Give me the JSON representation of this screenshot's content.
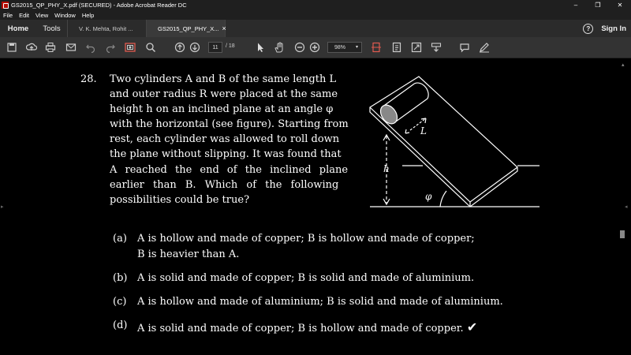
{
  "window": {
    "title": "GS2015_QP_PHY_X.pdf (SECURED) - Adobe Acrobat Reader DC",
    "controls": {
      "minimize": "–",
      "maximize": "❐",
      "close": "✕"
    }
  },
  "menu": [
    "File",
    "Edit",
    "View",
    "Window",
    "Help"
  ],
  "tabs": {
    "home": "Home",
    "tools": "Tools",
    "documents": [
      {
        "label": "V. K. Mehta, Rohit ...",
        "close": "",
        "active": false
      },
      {
        "label": "GS2015_QP_PHY_X...",
        "close": "×",
        "active": true
      }
    ],
    "help": "?",
    "sign_in": "Sign In"
  },
  "toolbar": {
    "page_current": "11",
    "page_total": "/ 18",
    "zoom": "98%",
    "zoom_caret": "▾",
    "icons": [
      "save-icon",
      "cloud-upload-icon",
      "print-icon",
      "email-icon",
      "undo-icon",
      "redo-icon",
      "snapshot-icon",
      "search-icon",
      "page-up-icon",
      "page-down-icon",
      "select-pointer-icon",
      "hand-icon",
      "zoom-out-icon",
      "zoom-in-icon",
      "fit-page-icon",
      "scroll-mode-icon",
      "full-screen-icon",
      "read-mode-icon",
      "comment-icon",
      "sign-icon"
    ]
  },
  "question": {
    "number": "28.",
    "lines": [
      "Two cylinders A and B of the same length L",
      "and outer radius R were placed at the same",
      "height h on an inclined plane at an angle φ",
      "with the horizontal (see figure). Starting from",
      "rest, each cylinder was allowed to roll down",
      "the plane without slipping. It was found that",
      "A reached the end of the inclined plane",
      "earlier than B. Which of the following",
      "possibilities could be true?"
    ],
    "figure_labels": {
      "length": "L",
      "height": "h",
      "angle": "φ"
    },
    "options": [
      {
        "label": "(a)",
        "lines": [
          "A is hollow and made of copper; B is hollow and made of copper;",
          "B is heavier than A."
        ]
      },
      {
        "label": "(b)",
        "lines": [
          "A is solid and made of copper; B is solid and made of aluminium."
        ]
      },
      {
        "label": "(c)",
        "lines": [
          "A is hollow and made of aluminium; B is solid and made of aluminium."
        ]
      },
      {
        "label": "(d)",
        "lines": [
          "A is solid and made of copper; B is hollow and made of copper."
        ],
        "mark": "✔"
      }
    ]
  },
  "colors": {
    "background": "#000000",
    "chrome": "#2b2b2b",
    "toolbar": "#333333",
    "text": "#ffffff",
    "acrobat_red": "#b30b00"
  }
}
